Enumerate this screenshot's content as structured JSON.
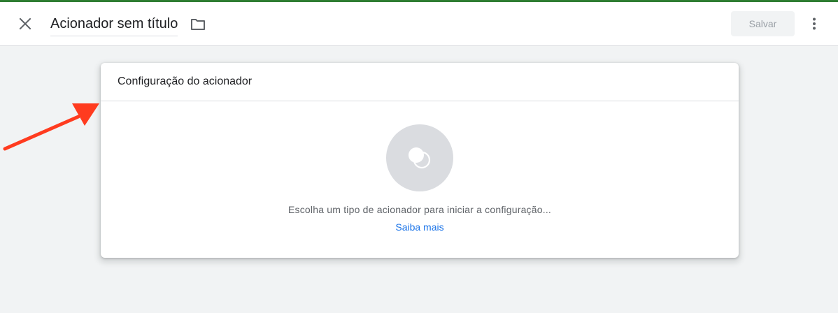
{
  "header": {
    "title": "Acionador sem título",
    "save_label": "Salvar"
  },
  "card": {
    "title": "Configuração do acionador",
    "hint": "Escolha um tipo de acionador para iniciar a configuração...",
    "learn_more": "Saiba mais"
  },
  "colors": {
    "top_bar": "#2e7d32",
    "link": "#1a73e8",
    "annotation_arrow": "#ff3b1f",
    "background": "#f1f3f4"
  },
  "icons": {
    "close": "close-icon",
    "folder": "folder-icon",
    "more": "more-vert-icon",
    "trigger": "trigger-type-icon",
    "annotation": "red-arrow-annotation"
  }
}
